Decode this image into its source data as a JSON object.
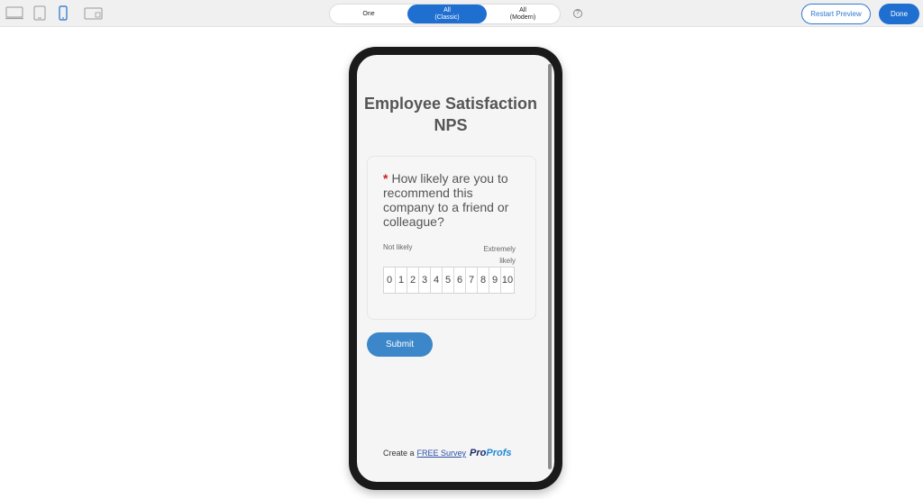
{
  "toolbar": {
    "devices": [
      {
        "name": "desktop-icon",
        "active": false
      },
      {
        "name": "tablet-icon",
        "active": false
      },
      {
        "name": "mobile-icon",
        "active": true
      },
      {
        "name": "tablet-landscape-icon",
        "active": false
      }
    ],
    "view_modes": [
      {
        "label": "One",
        "active": false
      },
      {
        "label": "All\n(Classic)",
        "active": true
      },
      {
        "label": "All\n(Modern)",
        "active": false
      }
    ],
    "help_label": "?",
    "restart_label": "Restart Preview",
    "done_label": "Done",
    "colors": {
      "accent": "#1f6fd1",
      "toolbar_bg": "#f0f0f0"
    }
  },
  "survey": {
    "title": "Employee Satisfaction NPS",
    "question": {
      "required_mark": "*",
      "text": "How likely are you to recommend this company to a friend or colleague?",
      "label_low": "Not likely",
      "label_high": "Extremely likely",
      "scale": [
        "0",
        "1",
        "2",
        "3",
        "4",
        "5",
        "6",
        "7",
        "8",
        "9",
        "10"
      ]
    },
    "submit_label": "Submit",
    "footer": {
      "prefix": "Create a",
      "link_text": "FREE Survey",
      "brand_part1": "Pro",
      "brand_part2": "Profs"
    },
    "colors": {
      "submit_bg": "#3b87c9",
      "required": "#cc1f1f",
      "text": "#555555"
    }
  }
}
